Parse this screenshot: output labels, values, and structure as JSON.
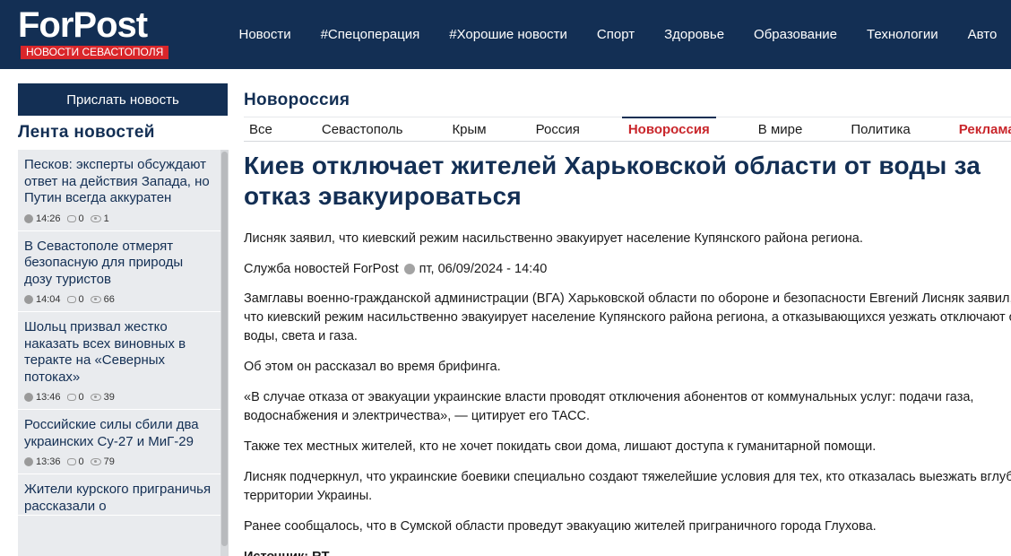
{
  "header": {
    "logo_title": "ForPost",
    "logo_subtitle": "НОВОСТИ СЕВАСТОПОЛЯ",
    "nav": [
      "Новости",
      "#Спецоперация",
      "#Хорошие новости",
      "Спорт",
      "Здоровье",
      "Образование",
      "Технологии",
      "Авто"
    ]
  },
  "sidebar": {
    "send_button": "Прислать новость",
    "feed_title": "Лента новостей",
    "items": [
      {
        "title": "Песков: эксперты обсуждают ответ на действия Запада, но Путин всегда аккуратен",
        "time": "14:26",
        "comments": "0",
        "views": "1"
      },
      {
        "title": "В Севастополе отмерят безопасную для природы дозу туристов",
        "time": "14:04",
        "comments": "0",
        "views": "66"
      },
      {
        "title": "Шольц призвал жестко наказать всех виновных в теракте на «Северных потоках»",
        "time": "13:46",
        "comments": "0",
        "views": "39"
      },
      {
        "title": "Российские силы сбили два украинских Су-27 и МиГ-29",
        "time": "13:36",
        "comments": "0",
        "views": "79"
      },
      {
        "title": "Жители курского приграничья рассказали о",
        "time": "",
        "comments": "",
        "views": ""
      }
    ]
  },
  "main": {
    "section_title": "Новороссия",
    "tabs": [
      "Все",
      "Севастополь",
      "Крым",
      "Россия",
      "Новороссия",
      "В мире",
      "Политика",
      "Реклама"
    ],
    "active_tab": "Новороссия",
    "headline": "Киев отключает жителей Харьковской области от воды за отказ эвакуироваться",
    "lead": "Лисняк заявил, что киевский режим насильственно эвакуирует население Купянского района региона.",
    "author": "Служба новостей ForPost",
    "date": "пт, 06/09/2024 - 14:40",
    "paragraphs": [
      "Замглавы военно-гражданской администрации (ВГА) Харьковской области по обороне и безопасности Евгений Лисняк заявил, что киевский режим насильственно эвакуирует население Купянского района региона, а отказывающихся уезжать отключают от воды, света и газа.",
      "Об этом он рассказал во время брифинга.",
      "«В случае отказа от эвакуации украинские власти проводят отключения абонентов от коммунальных услуг: подачи газа, водоснабжения и электричества», — цитирует его ТАСС.",
      "Также тех местных жителей, кто не хочет покидать свои дома, лишают доступа к гуманитарной помощи.",
      "Лисняк подчеркнул, что украинские боевики специально создают тяжелейшие условия для тех, кто отказалась выезжать вглубь территории Украины.",
      "Ранее сообщалось, что в Сумской области проведут эвакуацию жителей приграничного города Глухова."
    ],
    "source_label": "Источник: RT"
  },
  "colors": {
    "brand": "#132f54",
    "accent": "#c9262b",
    "feed_bg": "#e9ebee"
  }
}
